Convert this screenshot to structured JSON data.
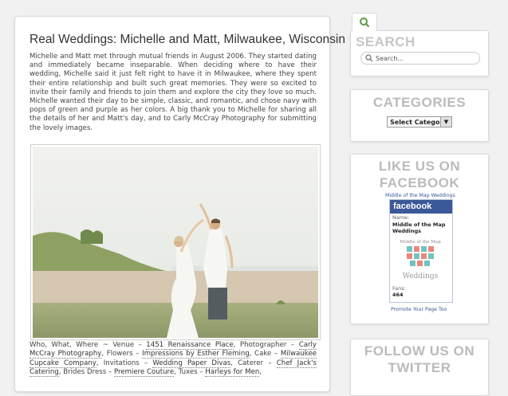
{
  "post": {
    "title": "Real Weddings: Michelle and Matt, Milwaukee, Wisconsin",
    "body": "Michelle and Matt met through mutual friends in August 2006.  They started dating and immediately became inseparable. When deciding where to have their wedding, Michelle said it just felt right to have it in Milwaukee, where they spent their entire relationship and built such great memories.  They were so excited to invite their family and friends to join them and explore the city they love so much. Michelle wanted their day to be simple, classic, and romantic, and chose navy with pops of green and purple as her colors.  A big thank you to Michelle for sharing all the details of her and Matt's day, and to Carly McCray Photography for submitting the lovely images.",
    "credits": [
      {
        "text": "Who, What, Where ~ Venue – "
      },
      {
        "link": "1451 Renaissance Place"
      },
      {
        "text": ", Photographer – "
      },
      {
        "link": "Carly McCray Photography"
      },
      {
        "text": ", Flowers – "
      },
      {
        "link": "Impressions by Esther Fleming"
      },
      {
        "text": ", Cake – "
      },
      {
        "link": "Milwaukee Cupcake Company"
      },
      {
        "text": ", Invitations – "
      },
      {
        "link": "Wedding Paper Divas"
      },
      {
        "text": ", Caterer – "
      },
      {
        "link": "Chef Jack's Catering"
      },
      {
        "text": ", Brides Dress – "
      },
      {
        "link": "Premiere Couture"
      },
      {
        "text": ", Tuxes – "
      },
      {
        "link": "Harleys for Men"
      },
      {
        "text": ","
      }
    ]
  },
  "sidebar": {
    "search": {
      "title": "SEARCH",
      "placeholder": "Search..."
    },
    "categories": {
      "title": "CATEGORIES",
      "selected": "Select Categor"
    },
    "facebook": {
      "title": "LIKE US ON FACEBOOK",
      "page_link": "Middle of the Map Weddings",
      "brand": "facebook",
      "name_label": "Name:",
      "name_value": "Middle of the Map Weddings",
      "logo_line1": "Middle of the Map",
      "logo_line2": "Weddings",
      "fans_label": "Fans:",
      "fans_value": "464",
      "promote": "Promote Your Page Too"
    },
    "twitter": {
      "title": "FOLLOW US ON TWITTER"
    }
  },
  "colors": {
    "facebook_blue": "#3b5998",
    "widget_title": "#bbbbbb",
    "search_icon": "#5a9a3c"
  }
}
